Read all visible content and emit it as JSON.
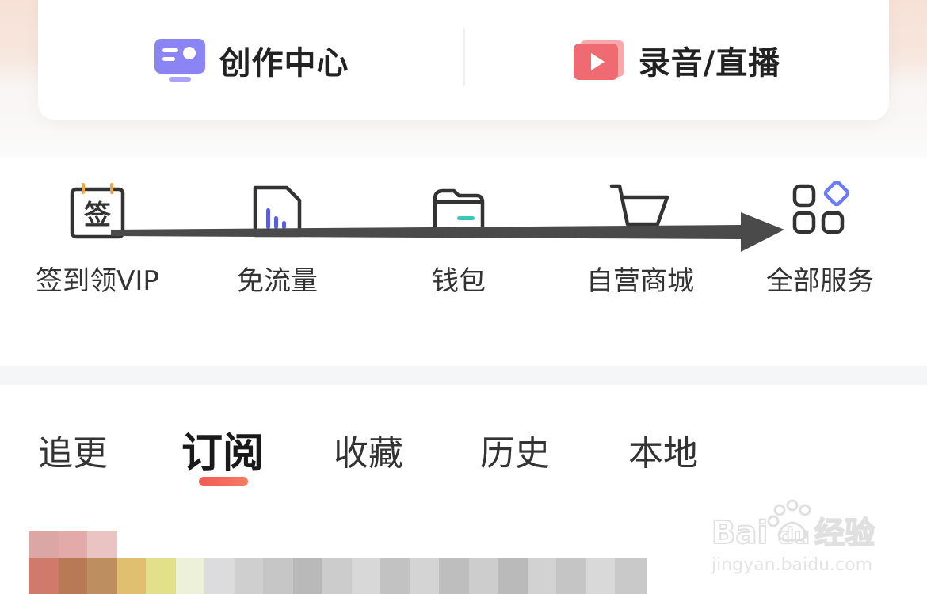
{
  "top_card": {
    "creator_center": {
      "label": "创作中心",
      "icon": "creator-dashboard-icon"
    },
    "record_live": {
      "label": "录音/直播",
      "icon": "play-video-icon"
    }
  },
  "services": [
    {
      "label": "签到领VIP",
      "icon": "calendar-checkin-icon",
      "icon_text": "签"
    },
    {
      "label": "免流量",
      "icon": "data-free-icon"
    },
    {
      "label": "钱包",
      "icon": "wallet-icon"
    },
    {
      "label": "自营商城",
      "icon": "shopping-cart-icon"
    },
    {
      "label": "全部服务",
      "icon": "all-services-grid-icon"
    }
  ],
  "tabs": [
    {
      "label": "追更",
      "active": false
    },
    {
      "label": "订阅",
      "active": true
    },
    {
      "label": "收藏",
      "active": false
    },
    {
      "label": "历史",
      "active": false
    },
    {
      "label": "本地",
      "active": false
    }
  ],
  "watermark": {
    "brand": "Bai",
    "brand_suffix": "du",
    "brand_cn": "经验",
    "url": "jingyan.baidu.com"
  },
  "colors": {
    "accent": "#f25b53",
    "creator_icon": "#8b84f5",
    "record_icon": "#f06a72",
    "arrow": "#4a4a4a"
  }
}
